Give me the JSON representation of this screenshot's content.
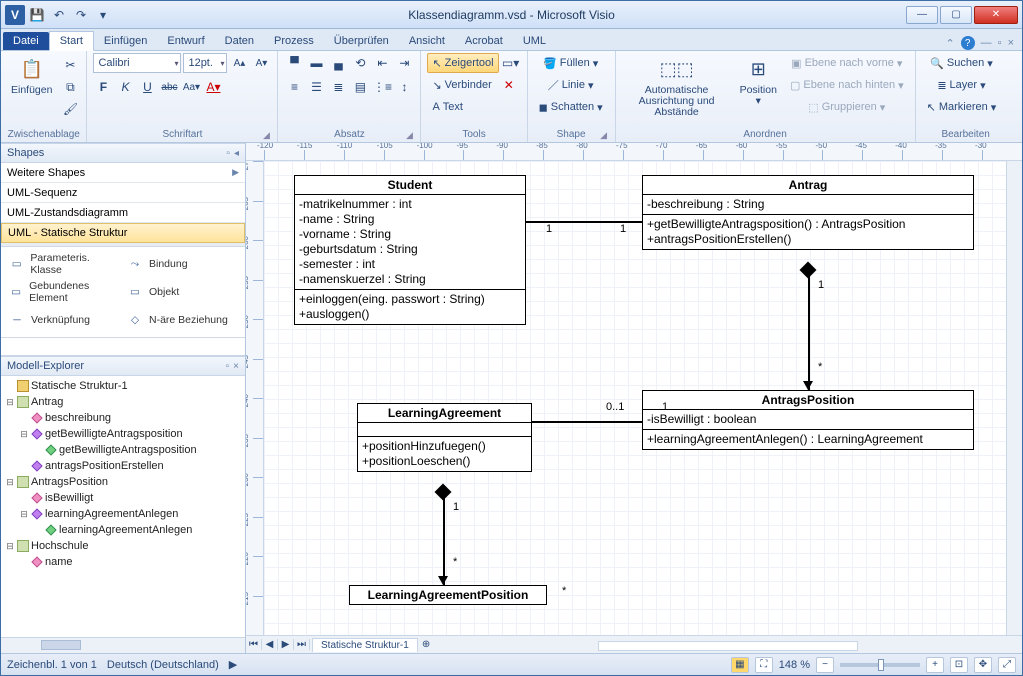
{
  "window": {
    "title": "Klassendiagramm.vsd - Microsoft Visio"
  },
  "qat": {
    "save": "💾",
    "undo": "↶",
    "redo": "↷"
  },
  "tabs": {
    "file": "Datei",
    "start": "Start",
    "einfuegen": "Einfügen",
    "entwurf": "Entwurf",
    "daten": "Daten",
    "prozess": "Prozess",
    "ueberpruefen": "Überprüfen",
    "ansicht": "Ansicht",
    "acrobat": "Acrobat",
    "uml": "UML"
  },
  "ribbon": {
    "clipboard": {
      "paste": "Einfügen",
      "label": "Zwischenablage"
    },
    "font": {
      "family": "Calibri",
      "size": "12pt.",
      "grow": "A▲",
      "shrink": "A▼",
      "bold": "F",
      "italic": "K",
      "underline": "U",
      "strike": "abc",
      "sub": "Aₐ",
      "color": "A",
      "label": "Schriftart"
    },
    "paragraph": {
      "label": "Absatz"
    },
    "tools": {
      "pointer": "Zeigertool",
      "connector": "Verbinder",
      "text": "Text",
      "label": "Tools"
    },
    "shape": {
      "fill": "Füllen",
      "line": "Linie",
      "shadow": "Schatten",
      "label": "Shape"
    },
    "arrange": {
      "auto": "Automatische Ausrichtung und Abstände",
      "position": "Position",
      "front": "Ebene nach vorne",
      "back": "Ebene nach hinten",
      "group": "Gruppieren",
      "label": "Anordnen"
    },
    "edit": {
      "find": "Suchen",
      "layer": "Layer",
      "select": "Markieren",
      "label": "Bearbeiten"
    }
  },
  "shapes_pane": {
    "title": "Shapes",
    "more": "Weitere Shapes",
    "cat1": "UML-Sequenz",
    "cat2": "UML-Zustandsdiagramm",
    "cat3": "UML - Statische Struktur",
    "items": {
      "param": "Parameteris. Klasse",
      "bindung": "Bindung",
      "gebund": "Gebundenes Element",
      "objekt": "Objekt",
      "verk": "Verknüpfung",
      "nare": "N-äre Beziehung"
    }
  },
  "model_explorer": {
    "title": "Modell-Explorer",
    "root": "Statische Struktur-1",
    "antrag": "Antrag",
    "beschreibung": "beschreibung",
    "getB": "getBewilligteAntragsposition",
    "getBret": "getBewilligteAntragsposition",
    "antErst": "antragsPositionErstellen",
    "antragsPos": "AntragsPosition",
    "isBew": "isBewilligt",
    "laAnlegen": "learningAgreementAnlegen",
    "laAnlegenRet": "learningAgreementAnlegen",
    "hochschule": "Hochschule",
    "name": "name"
  },
  "ruler_h": [
    "-120",
    "-115",
    "-110",
    "-105",
    "-100",
    "-95",
    "-90",
    "-85",
    "-80",
    "-75",
    "-70",
    "-65",
    "-60",
    "-55",
    "-50",
    "-45",
    "-40",
    "-35",
    "-30"
  ],
  "ruler_v": [
    "270",
    "265",
    "260",
    "255",
    "250",
    "245",
    "240",
    "235",
    "230",
    "225",
    "220",
    "215",
    "210"
  ],
  "uml": {
    "student": {
      "name": "Student",
      "attrs": [
        "-matrikelnummer : int",
        "-name : String",
        "-vorname : String",
        "-geburtsdatum : String",
        "-semester : int",
        "-namenskuerzel : String"
      ],
      "ops": [
        "+einloggen(eing. passwort : String)",
        "+ausloggen()"
      ]
    },
    "antrag": {
      "name": "Antrag",
      "attrs": [
        "-beschreibung : String"
      ],
      "ops": [
        "+getBewilligteAntragsposition() : AntragsPosition",
        "+antragsPositionErstellen()"
      ]
    },
    "antragspos": {
      "name": "AntragsPosition",
      "attrs": [
        "-isBewilligt : boolean"
      ],
      "ops": [
        "+learningAgreementAnlegen() : LearningAgreement"
      ]
    },
    "la": {
      "name": "LearningAgreement",
      "ops": [
        "+positionHinzufuegen()",
        "+positionLoeschen()"
      ]
    },
    "lap": {
      "name": "LearningAgreementPosition"
    },
    "mults": {
      "one": "1",
      "zeroone": "0..1",
      "star": "*"
    }
  },
  "page_tab": "Statische Struktur-1",
  "status": {
    "sheet": "Zeichenbl. 1 von 1",
    "lang": "Deutsch (Deutschland)",
    "zoom": "148 %"
  }
}
